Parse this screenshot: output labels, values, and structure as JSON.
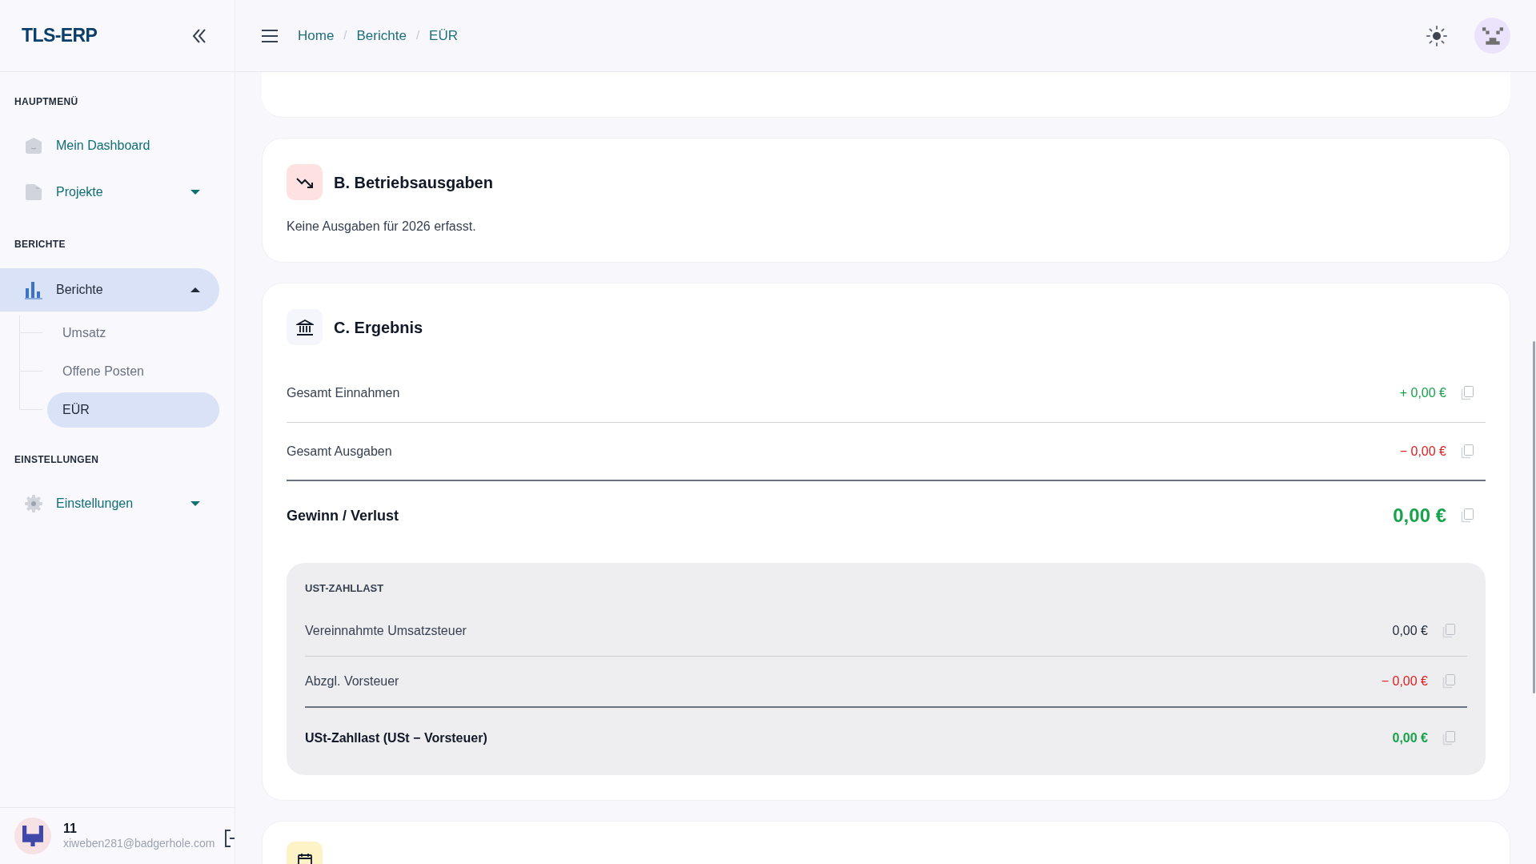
{
  "sidebar": {
    "logo": "TLS-ERP",
    "sections": [
      {
        "title": "HAUPTMENÜ",
        "items": [
          {
            "label": "Mein Dashboard",
            "selected": false
          },
          {
            "label": "Projekte",
            "selected": false,
            "expanded": false
          }
        ]
      },
      {
        "title": "BERICHTE",
        "items": [
          {
            "label": "Berichte",
            "selected": true,
            "expanded": true,
            "children": [
              {
                "label": "Umsatz",
                "selected": false
              },
              {
                "label": "Offene Posten",
                "selected": false
              },
              {
                "label": "EÜR",
                "selected": true
              }
            ]
          }
        ]
      },
      {
        "title": "EINSTELLUNGEN",
        "items": [
          {
            "label": "Einstellungen",
            "selected": false,
            "expanded": false
          }
        ]
      }
    ],
    "user": {
      "name": "11",
      "email": "xiweben281@badgerhole.com"
    }
  },
  "header": {
    "breadcrumbs": [
      "Home",
      "Berichte",
      "EÜR"
    ],
    "separators": [
      "/",
      "/"
    ]
  },
  "cards": [
    {
      "kind": "partial"
    },
    {
      "kind": "section",
      "title": "B. Betriebsausgaben",
      "color": "#fee2e2",
      "empty_text": "Keine Ausgaben für 2026 erfasst."
    },
    {
      "kind": "result",
      "title": "C. Ergebnis",
      "color": "#f5f6fb",
      "rows": [
        {
          "label": "Gesamt Einnahmen",
          "value": "+ 0,00 €",
          "color": "#16a34a"
        },
        {
          "label": "Gesamt Ausgaben",
          "value": "− 0,00 €",
          "color": "#e11d1d"
        }
      ],
      "total": {
        "label": "Gewinn / Verlust",
        "value": "0,00 €",
        "color": "#16a34a"
      },
      "tax": {
        "title": "UST-ZAHLLAST",
        "rows": [
          {
            "label": "Vereinnahmte Umsatzsteuer",
            "value": "0,00 €",
            "color": "#1f2937"
          },
          {
            "label": "Abzgl. Vorsteuer",
            "value": "− 0,00 €",
            "color": "#e11d1d"
          }
        ],
        "total": {
          "label": "USt-Zahllast (USt − Vorsteuer)",
          "value": "0,00 €",
          "color": "#16a34a"
        }
      }
    },
    {
      "kind": "section",
      "color": "#fef3c7"
    }
  ]
}
